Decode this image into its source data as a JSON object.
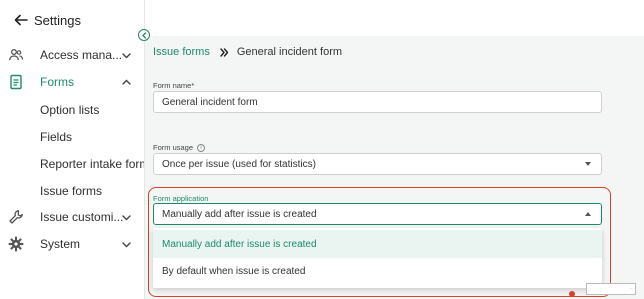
{
  "header": {
    "back_label": "Settings"
  },
  "sidebar": {
    "items": [
      {
        "label": "Access mana...",
        "icon": "users-icon"
      },
      {
        "label": "Forms",
        "icon": "document-icon"
      },
      {
        "label": "Issue customi...",
        "icon": "wrench-icon"
      },
      {
        "label": "System",
        "icon": "gear-icon"
      }
    ],
    "sub_items": [
      "Option lists",
      "Fields",
      "Reporter intake forms",
      "Issue forms"
    ]
  },
  "breadcrumb": {
    "parent": "Issue forms",
    "current": "General incident form"
  },
  "form": {
    "name_label": "Form name*",
    "name_value": "General incident form",
    "usage_label": "Form usage",
    "usage_info": "i",
    "usage_value": "Once per issue (used for statistics)",
    "application_label": "Form application",
    "application_value": "Manually add after issue is created",
    "application_options": [
      "Manually add after issue is created",
      "By default when issue is created"
    ]
  },
  "colors": {
    "accent": "#1e8a6b",
    "highlight": "#d9402b"
  }
}
